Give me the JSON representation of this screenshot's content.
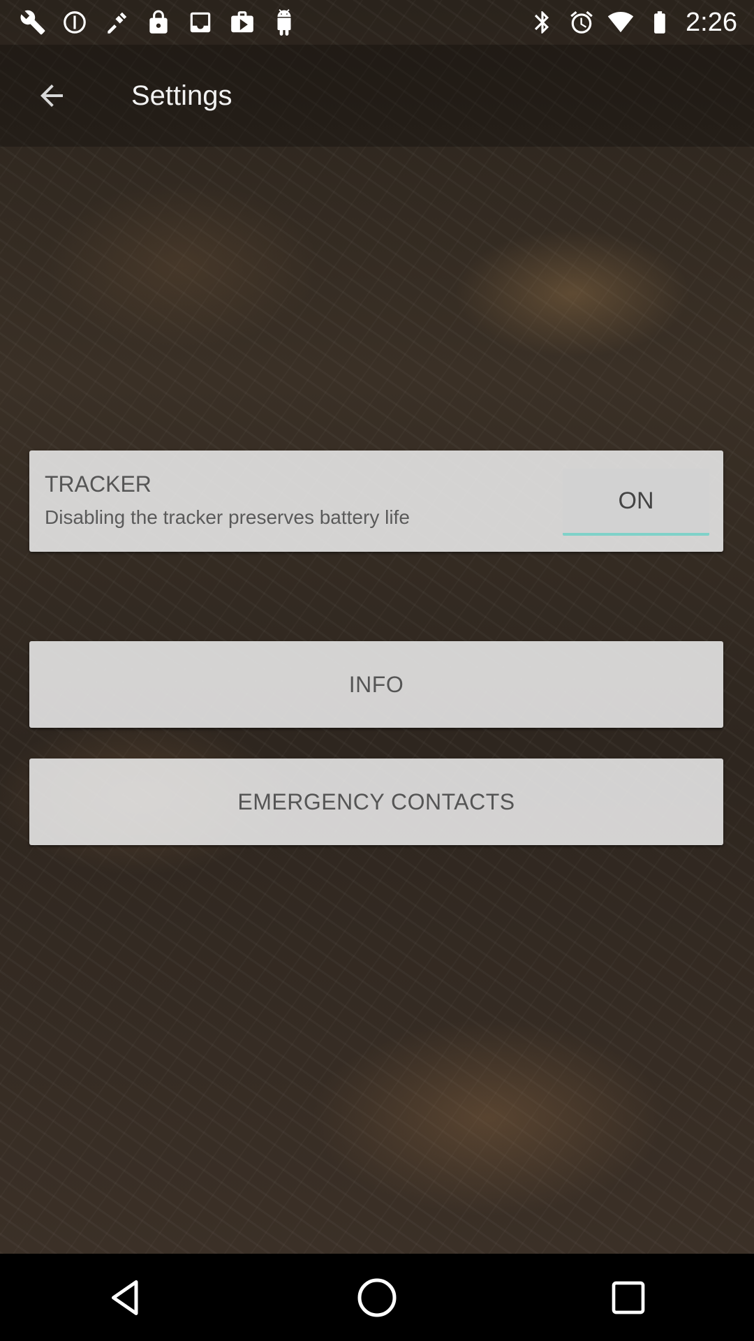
{
  "status_bar": {
    "time": "2:26",
    "left_icons": [
      "wrench-icon",
      "sync-icon",
      "fake-gps-icon",
      "lock-icon",
      "inbox-icon",
      "play-store-icon",
      "android-icon"
    ],
    "right_icons": [
      "bluetooth-icon",
      "alarm-icon",
      "wifi-icon",
      "battery-icon"
    ]
  },
  "app_bar": {
    "title": "Settings",
    "back_icon": "arrow-back-icon"
  },
  "tracker": {
    "title": "TRACKER",
    "description": "Disabling the tracker preserves battery life",
    "toggle_label": "ON"
  },
  "buttons": {
    "info": "INFO",
    "emergency_contacts": "EMERGENCY CONTACTS"
  },
  "nav_bar": {
    "icons": [
      "back-triangle-icon",
      "home-circle-icon",
      "recents-square-icon"
    ]
  },
  "colors": {
    "toggle_underline": "#7fd1c8",
    "card_bg": "#ebebeb",
    "text_primary": "#555555"
  }
}
